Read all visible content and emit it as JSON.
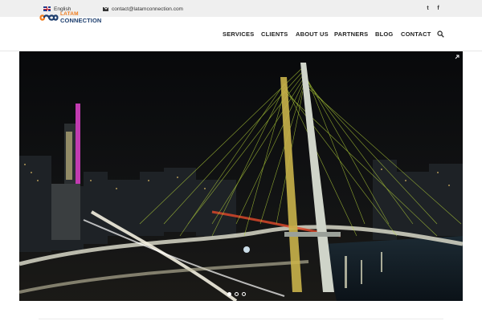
{
  "topbar": {
    "language": "English",
    "email": "contact@latamconnection.com",
    "social": [
      {
        "name": "twitter",
        "glyph": "t"
      },
      {
        "name": "facebook",
        "glyph": "f"
      }
    ]
  },
  "logo": {
    "line1": "LATAM",
    "line2": "CONNECTION"
  },
  "nav": {
    "items": [
      "SERVICES",
      "CLIENTS",
      "ABOUT US",
      "PARTNERS",
      "BLOG",
      "CONTACT"
    ]
  },
  "colors": {
    "accent_orange": "#f07b1b",
    "brand_navy": "#1d3e6e",
    "topbar_bg": "#efefef"
  },
  "hero": {
    "image_subject": "cable-stayed bridge at night",
    "slides_count": 3,
    "active_slide": 1
  },
  "icons": {
    "flag": "uk-flag-icon",
    "mail": "envelope-icon",
    "search": "search-icon",
    "expand": "expand-icon"
  }
}
